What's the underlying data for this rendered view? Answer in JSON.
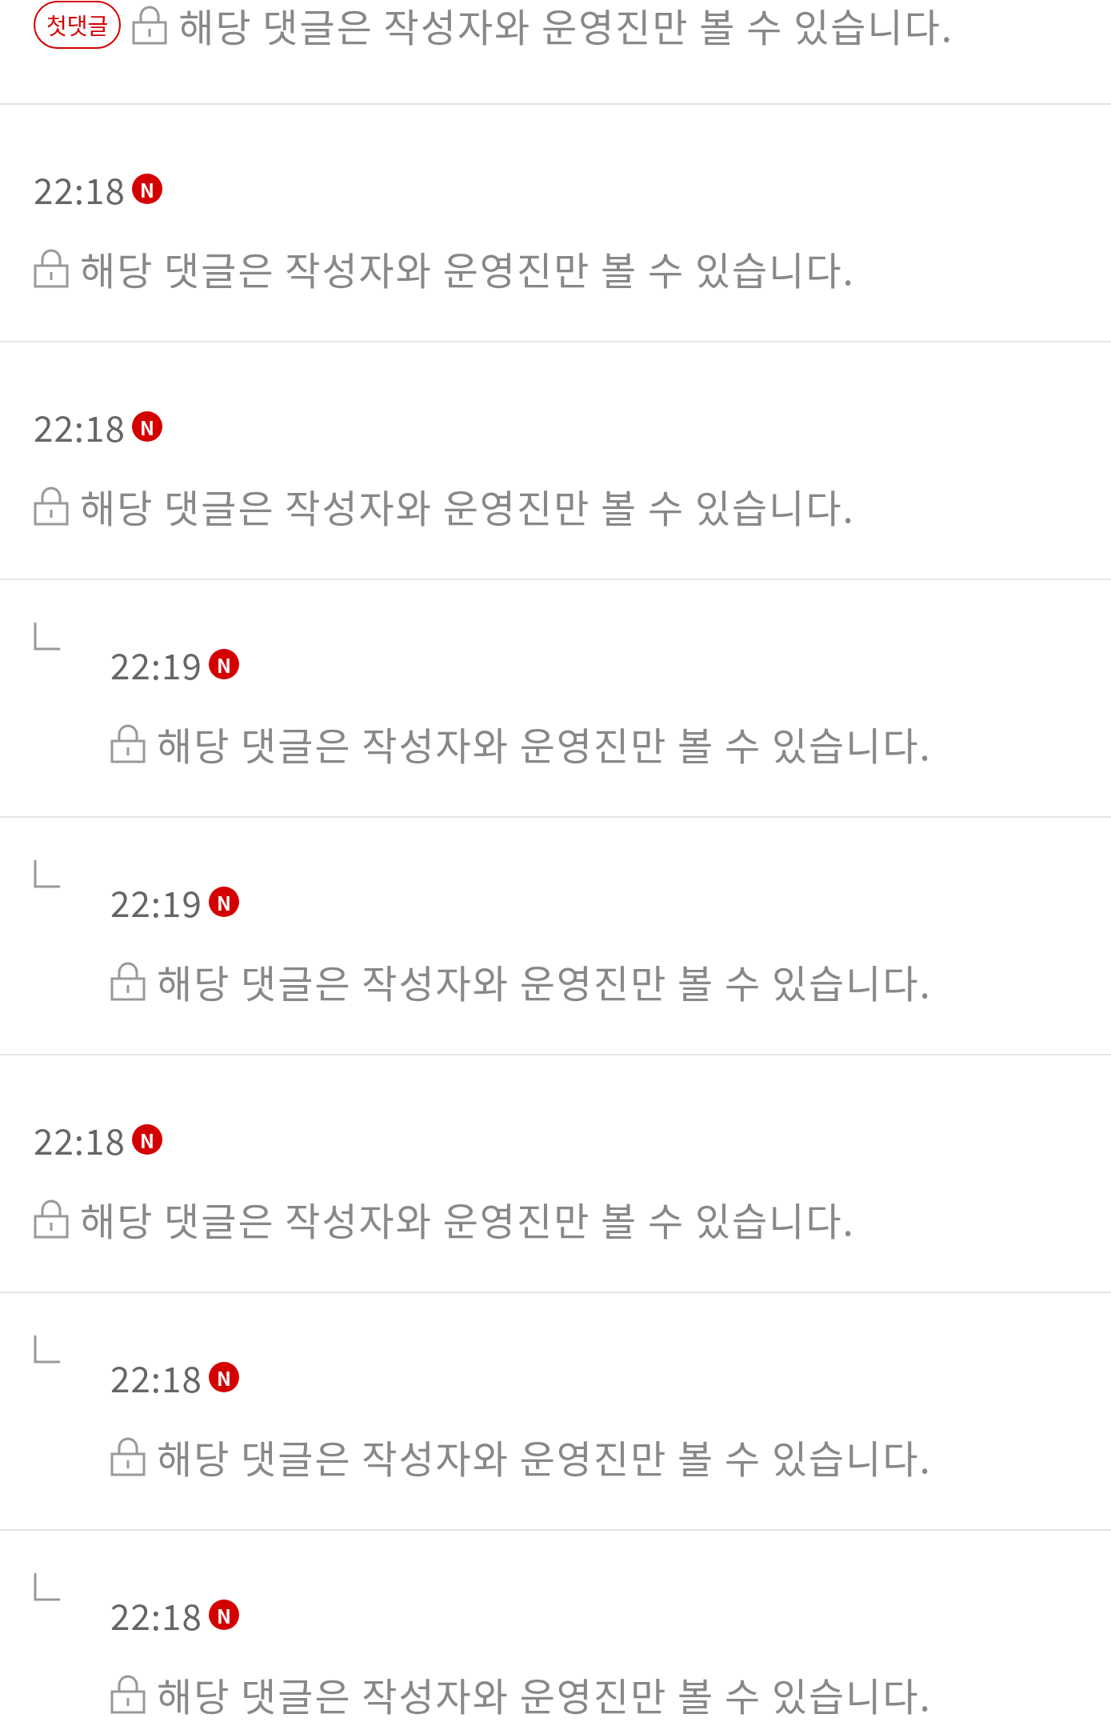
{
  "first_comment": {
    "badge": "첫댓글",
    "message": "해당 댓글은 작성자와 운영진만 볼 수 있습니다."
  },
  "comments": [
    {
      "kind": "comment",
      "time": "22:18",
      "new_mark": "N",
      "message": "해당 댓글은 작성자와 운영진만 볼 수 있습니다."
    },
    {
      "kind": "comment",
      "time": "22:18",
      "new_mark": "N",
      "message": "해당 댓글은 작성자와 운영진만 볼 수 있습니다."
    },
    {
      "kind": "reply",
      "time": "22:19",
      "new_mark": "N",
      "message": "해당 댓글은 작성자와 운영진만 볼 수 있습니다."
    },
    {
      "kind": "reply",
      "time": "22:19",
      "new_mark": "N",
      "message": "해당 댓글은 작성자와 운영진만 볼 수 있습니다."
    },
    {
      "kind": "comment",
      "time": "22:18",
      "new_mark": "N",
      "message": "해당 댓글은 작성자와 운영진만 볼 수 있습니다."
    },
    {
      "kind": "reply",
      "time": "22:18",
      "new_mark": "N",
      "message": "해당 댓글은 작성자와 운영진만 볼 수 있습니다."
    },
    {
      "kind": "reply",
      "time": "22:18",
      "new_mark": "N",
      "message": "해당 댓글은 작성자와 운영진만 볼 수 있습니다."
    }
  ]
}
